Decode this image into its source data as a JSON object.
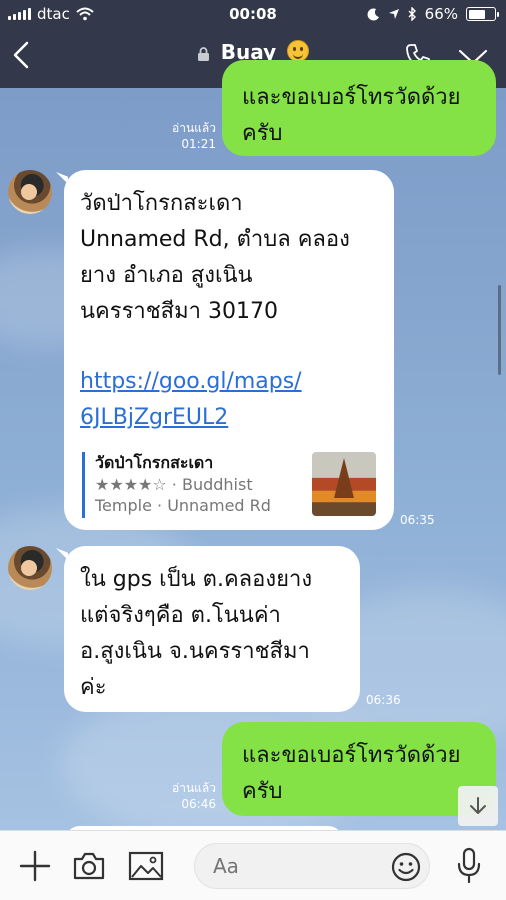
{
  "status_bar": {
    "carrier": "dtac",
    "time": "00:08",
    "battery": "66%",
    "battery_level": 0.66
  },
  "header": {
    "title": "Buay"
  },
  "messages": [
    {
      "direction": "out",
      "text_lines": [
        "และขอเบอร์โทรวัดด้วย",
        "ครับ"
      ],
      "read_label": "อ่านแล้ว",
      "time": "01:21"
    },
    {
      "direction": "in",
      "text_lines": [
        "วัดป่าโกรกสะเดา",
        "Unnamed Rd, ตำบล คลอง",
        "ยาง อำเภอ สูงเนิน",
        "นครราชสีมา 30170"
      ],
      "link_lines": [
        "https://goo.gl/maps/",
        "6JLBjZgrEUL2"
      ],
      "preview": {
        "title": "วัดป่าโกรกสะเดา",
        "subtitle": "★★★★☆ · Buddhist Temple · Unnamed Rd"
      },
      "time": "06:35"
    },
    {
      "direction": "in",
      "text_lines": [
        "ใน gps เป็น ต.คลองยาง",
        "แต่จริงๆคือ ต.โนนค่า",
        "อ.สูงเนิน จ.นครราชสีมา",
        "ค่ะ"
      ],
      "time": "06:36"
    },
    {
      "direction": "out",
      "text_lines": [
        "และขอเบอร์โทรวัดด้วย",
        "ครับ"
      ],
      "read_label": "อ่านแล้ว",
      "time": "06:46"
    }
  ],
  "input_bar": {
    "placeholder": "Aa"
  },
  "icons": {
    "back": "chevron-left-icon",
    "lock": "lock-icon",
    "call": "phone-icon",
    "more": "chevron-down-icon",
    "add": "plus-icon",
    "camera": "camera-icon",
    "image": "image-icon",
    "emoji": "emoji-icon",
    "mic": "microphone-icon",
    "scroll": "arrow-down-icon"
  },
  "colors": {
    "header_bg": "#34384b",
    "outgoing_bubble": "#84e247",
    "incoming_bubble": "#ffffff",
    "link": "#2a6fd6"
  }
}
